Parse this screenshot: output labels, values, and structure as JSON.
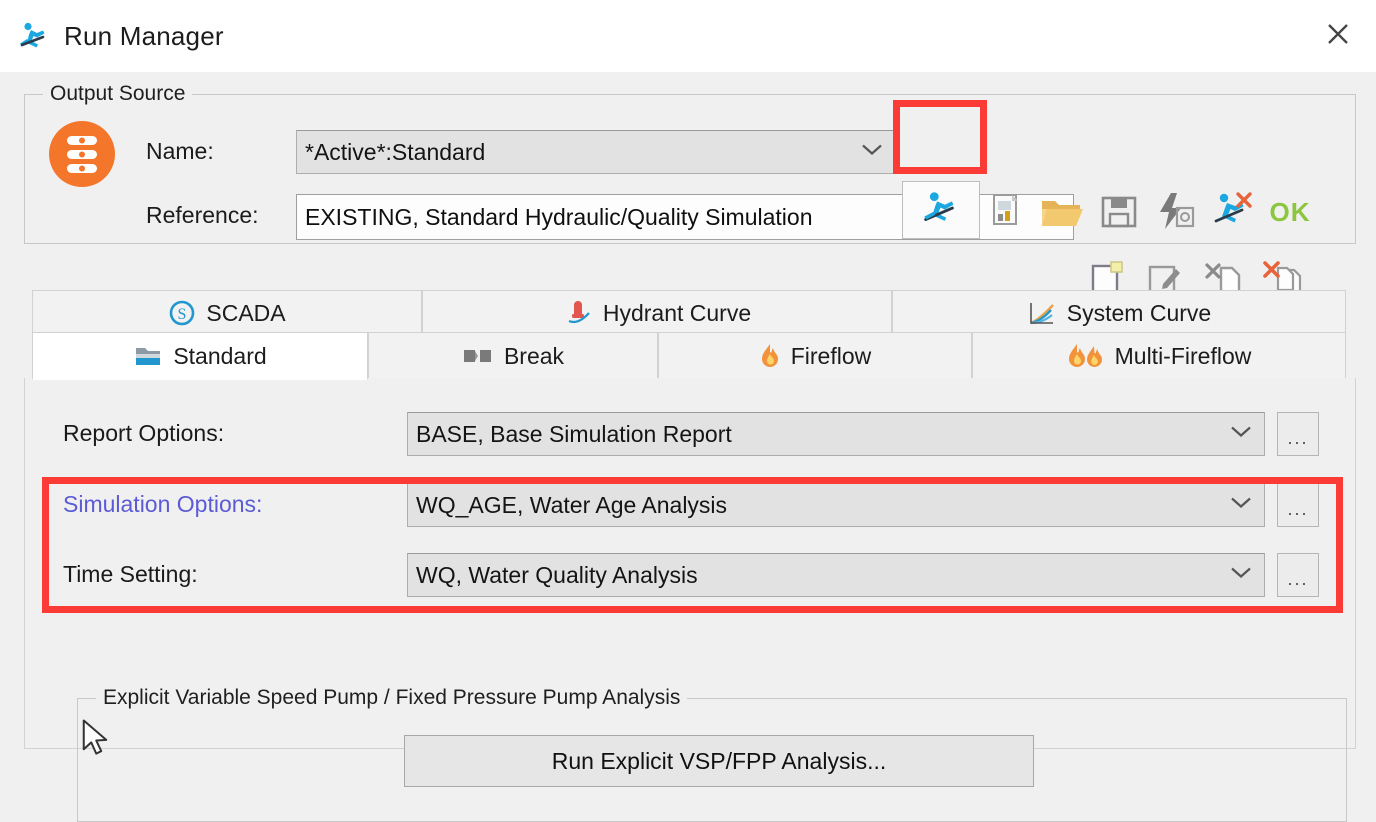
{
  "window": {
    "title": "Run Manager",
    "title_icon": "runner-icon",
    "close_icon": "close-icon"
  },
  "output_source": {
    "legend": "Output Source",
    "status_icon": "traffic-light-icon",
    "name_label": "Name:",
    "name_value": "*Active*:Standard",
    "reference_label": "Reference:",
    "reference_value": "EXISTING, Standard Hydraulic/Quality Simulation",
    "toolbar_row1": [
      {
        "name": "run-icon",
        "title": "Run"
      },
      {
        "name": "report-icon",
        "title": "Report"
      },
      {
        "name": "open-folder-icon",
        "title": "Open"
      },
      {
        "name": "save-icon",
        "title": "Save"
      },
      {
        "name": "quick-run-icon",
        "title": "Quick Run"
      },
      {
        "name": "cancel-run-icon",
        "title": "Cancel Run"
      },
      {
        "name": "ok-icon",
        "title": "OK"
      }
    ],
    "toolbar_row2": [
      {
        "name": "new-page-icon",
        "title": "New"
      },
      {
        "name": "edit-page-icon",
        "title": "Edit"
      },
      {
        "name": "delete-page-icon",
        "title": "Delete"
      },
      {
        "name": "delete-all-pages-icon",
        "title": "Delete All"
      }
    ]
  },
  "tabs_top": [
    {
      "label": "SCADA",
      "icon": "scada-circle-s-icon",
      "active": false
    },
    {
      "label": "Hydrant Curve",
      "icon": "hydrant-icon",
      "active": false
    },
    {
      "label": "System Curve",
      "icon": "system-curve-chart-icon",
      "active": false
    }
  ],
  "tabs_bottom": [
    {
      "label": "Standard",
      "icon": "folder-icon",
      "active": true
    },
    {
      "label": "Break",
      "icon": "broken-pipe-icon",
      "active": false
    },
    {
      "label": "Fireflow",
      "icon": "flame-icon",
      "active": false
    },
    {
      "label": "Multi-Fireflow",
      "icon": "double-flame-icon",
      "active": false
    }
  ],
  "standard_tab": {
    "rows": [
      {
        "label": "Report Options:",
        "value": "BASE, Base Simulation Report",
        "highlighted_label": false,
        "ellipsis": "..."
      },
      {
        "label": "Simulation Options:",
        "value": "WQ_AGE, Water Age Analysis",
        "highlighted_label": true,
        "ellipsis": "..."
      },
      {
        "label": "Time Setting:",
        "value": "WQ, Water Quality Analysis",
        "highlighted_label": false,
        "ellipsis": "..."
      }
    ],
    "vsp_group_legend": "Explicit Variable Speed Pump / Fixed Pressure Pump Analysis",
    "vsp_button": "Run Explicit VSP/FPP Analysis..."
  },
  "annotations": {
    "highlight_color": "#fb3b36",
    "boxes": [
      {
        "name": "run-button-highlight"
      },
      {
        "name": "simulation-options-rows-highlight"
      }
    ]
  },
  "colors": {
    "accent_link": "#5b5bd6",
    "traffic_orange": "#f4762a",
    "runner_blue": "#1ba7e0",
    "ok_green": "#8cc63e",
    "window_bg": "#f0f0f0",
    "titlebar_bg": "#ffffff"
  }
}
